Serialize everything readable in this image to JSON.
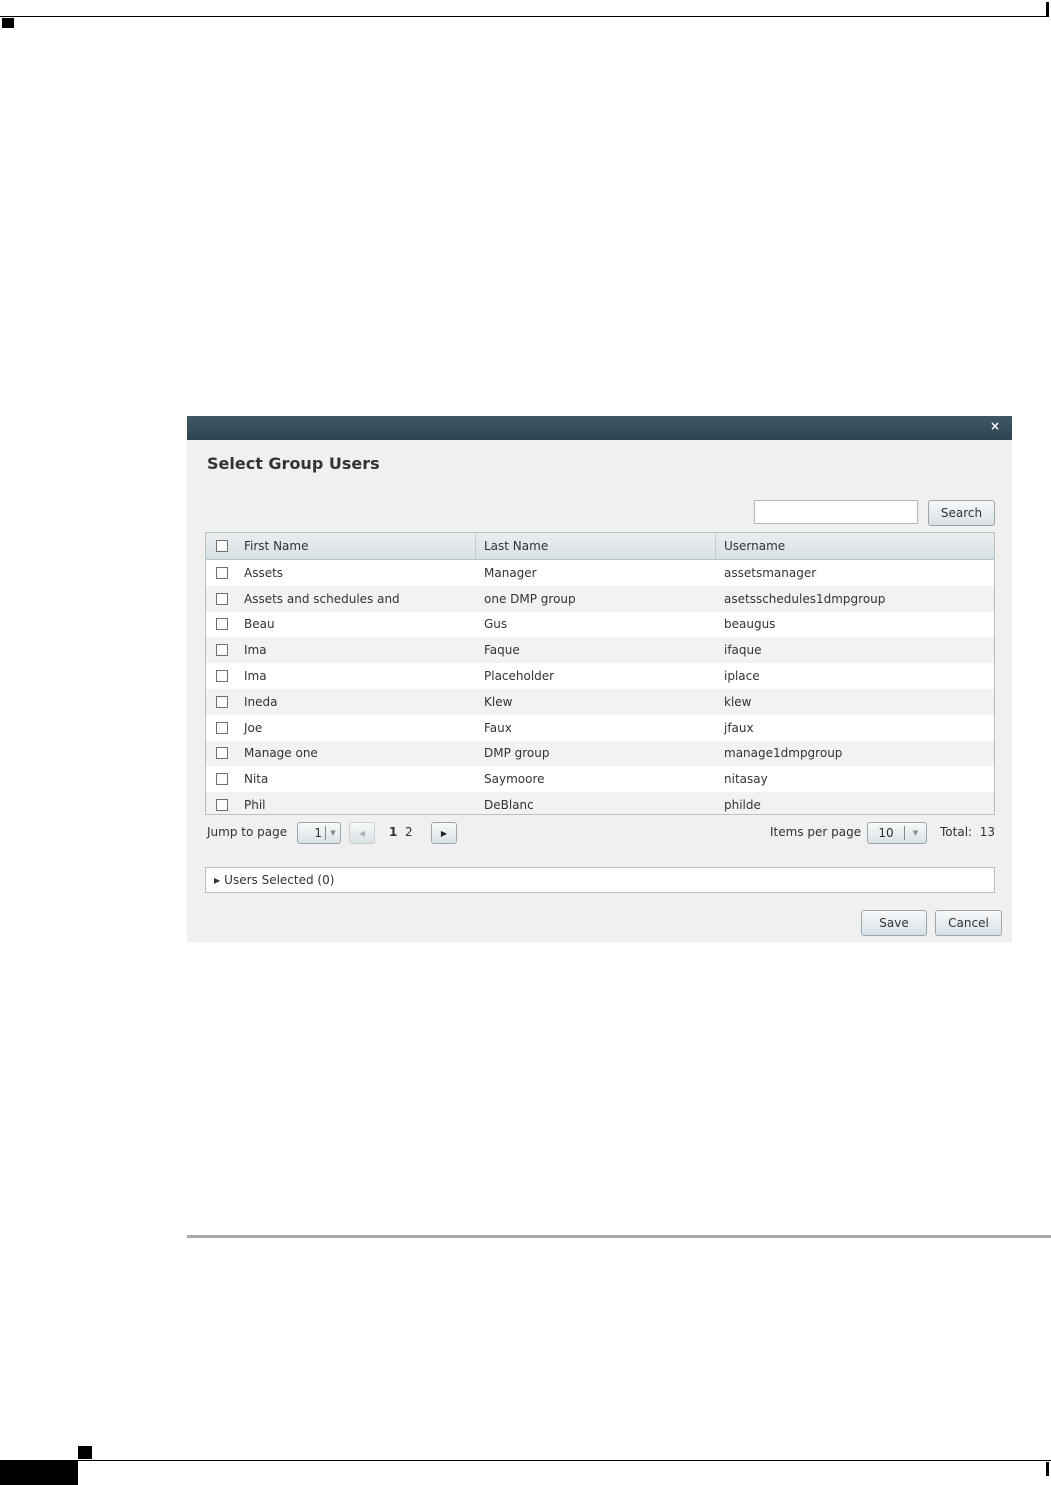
{
  "dialog": {
    "title": "Select Group Users",
    "close_icon": "×",
    "search": {
      "value": "",
      "button_label": "Search"
    },
    "grid": {
      "columns": [
        "First Name",
        "Last Name",
        "Username"
      ],
      "rows": [
        [
          "Assets",
          "Manager",
          "assetsmanager"
        ],
        [
          "Assets and schedules and",
          "one DMP group",
          "asetsschedules1dmpgroup"
        ],
        [
          "Beau",
          "Gus",
          "beaugus"
        ],
        [
          "Ima",
          "Faque",
          "ifaque"
        ],
        [
          "Ima",
          "Placeholder",
          "iplace"
        ],
        [
          "Ineda",
          "Klew",
          "klew"
        ],
        [
          "Joe",
          "Faux",
          "jfaux"
        ],
        [
          "Manage one",
          "DMP group",
          "manage1dmpgroup"
        ],
        [
          "Nita",
          "Saymoore",
          "nitasay"
        ],
        [
          "Phil",
          "DeBlanc",
          "philde"
        ]
      ]
    },
    "pager": {
      "jump_label": "Jump to page",
      "page_select_value": "1",
      "pages": [
        "1",
        "2"
      ],
      "items_per_page_label": "Items per page",
      "items_per_page_value": "10",
      "total_label": "Total:  13"
    },
    "users_selected_label": "Users Selected (0)",
    "save_label": "Save",
    "cancel_label": "Cancel"
  }
}
